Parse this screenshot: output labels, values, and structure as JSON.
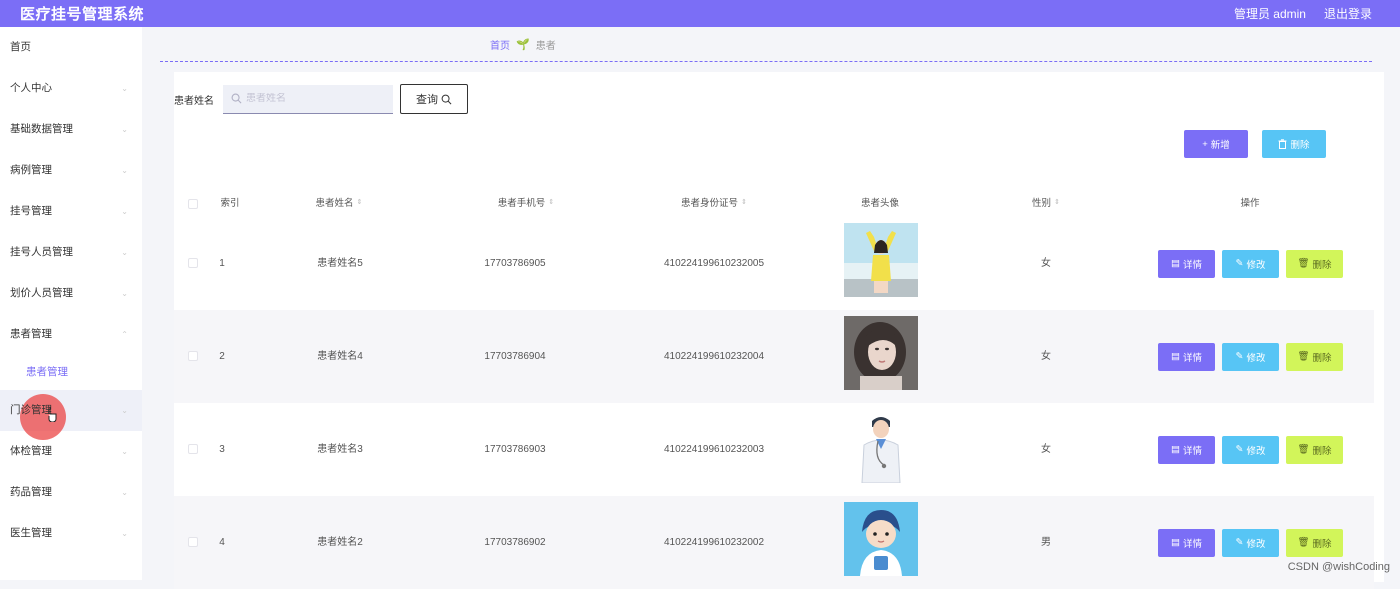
{
  "app": {
    "title": "医疗挂号管理系统",
    "user": "管理员 admin",
    "logout": "退出登录"
  },
  "sidebar": {
    "items": [
      {
        "label": "首页"
      },
      {
        "label": "个人中心"
      },
      {
        "label": "基础数据管理"
      },
      {
        "label": "病例管理"
      },
      {
        "label": "挂号管理"
      },
      {
        "label": "挂号人员管理"
      },
      {
        "label": "划价人员管理"
      },
      {
        "label": "患者管理"
      },
      {
        "label": "门诊管理"
      },
      {
        "label": "体检管理"
      },
      {
        "label": "药品管理"
      },
      {
        "label": "医生管理"
      }
    ],
    "sub_item": "患者管理"
  },
  "breadcrumb": {
    "home": "首页",
    "current": "患者"
  },
  "search": {
    "label": "患者姓名",
    "placeholder": "患者姓名",
    "value": "",
    "button": "查询"
  },
  "toolbar": {
    "add_label": "新增",
    "delete_label": "删除"
  },
  "table": {
    "headers": {
      "index": "索引",
      "name": "患者姓名",
      "phone": "患者手机号",
      "id_card": "患者身份证号",
      "avatar": "患者头像",
      "gender": "性别",
      "actions": "操作"
    },
    "rows": [
      {
        "index": "1",
        "name": "患者姓名5",
        "phone": "17703786905",
        "id_card": "410224199610232005",
        "gender": "女",
        "avatar": "woman-yellow-jacket-photo"
      },
      {
        "index": "2",
        "name": "患者姓名4",
        "phone": "17703786904",
        "id_card": "410224199610232004",
        "gender": "女",
        "avatar": "woman-portrait-photo"
      },
      {
        "index": "3",
        "name": "患者姓名3",
        "phone": "17703786903",
        "id_card": "410224199610232003",
        "gender": "女",
        "avatar": "doctor-illustration"
      },
      {
        "index": "4",
        "name": "患者姓名2",
        "phone": "17703786902",
        "id_card": "410224199610232002",
        "gender": "男",
        "avatar": "cartoon-doctor-illustration"
      }
    ],
    "action_labels": {
      "detail": "详情",
      "edit": "修改",
      "delete": "删除"
    }
  },
  "watermark": "CSDN @wishCoding",
  "colors": {
    "accent": "#7b6ef6",
    "edit": "#57c5f5",
    "delete": "#d2f55a",
    "cursor_highlight": "#eb4646"
  }
}
